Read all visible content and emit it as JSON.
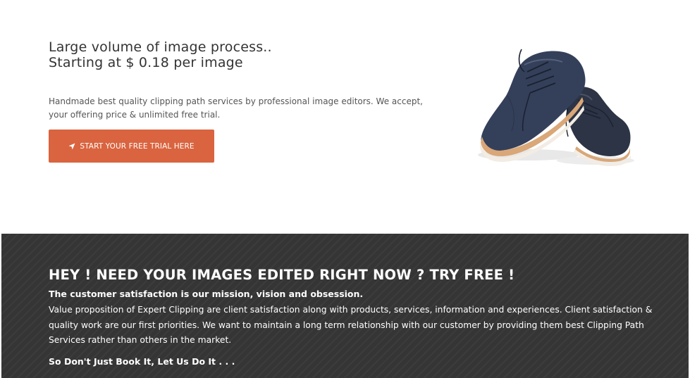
{
  "hero": {
    "title_line1": "Large volume of image process..",
    "title_line2": "Starting at $ 0.18 per image",
    "description": "Handmade best quality clipping path services by professional image editors. We accept, your offering price & unlimited free trial.",
    "cta_label": "START YOUR FREE TRIAL HERE",
    "cta_icon": "location-arrow-icon",
    "image": "shoes-product-image"
  },
  "promo": {
    "heading": "HEY ! NEED YOUR IMAGES EDITED RIGHT NOW ? TRY FREE !",
    "subheading": "The customer satisfaction is our mission, vision and obsession.",
    "body": "Value proposition of Expert Clipping are client satisfaction along with products, services, information and experiences. Client satisfaction & quality work are our first priorities. We want to maintain a long term relationship with our customer by providing them best Clipping Path Services  rather than others in the market.",
    "tagline": "So Don't Just Book It, Let Us Do It . . ."
  },
  "colors": {
    "accent": "#d9643f",
    "dark_bg": "#353535",
    "text_dark": "#333333"
  }
}
